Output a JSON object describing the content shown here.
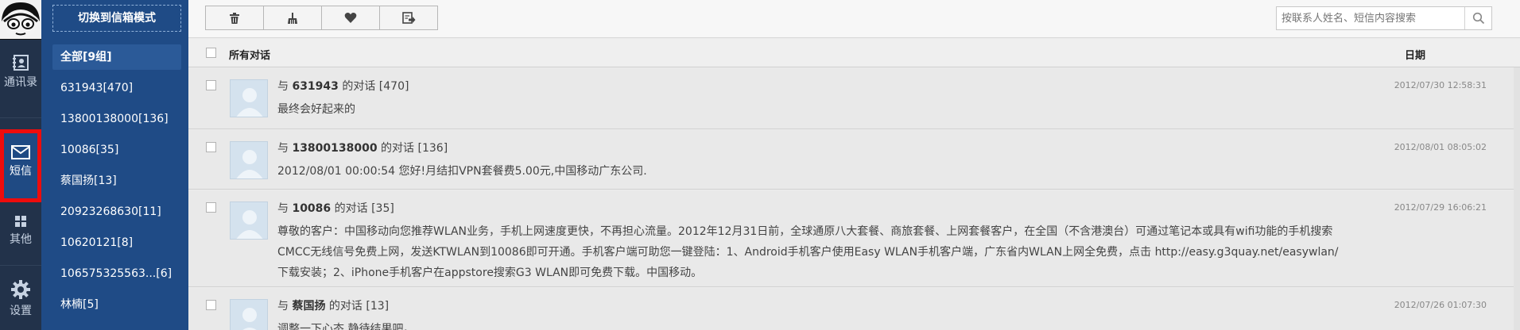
{
  "nav": {
    "contacts_label": "通讯录",
    "sms_label": "短信",
    "other_label": "其他",
    "settings_label": "设置"
  },
  "groups": {
    "switch_label": "切换到信箱模式",
    "items": [
      {
        "label": "全部[9组]"
      },
      {
        "label": "631943[470]"
      },
      {
        "label": "13800138000[136]"
      },
      {
        "label": "10086[35]"
      },
      {
        "label": "蔡国扬[13]"
      },
      {
        "label": "20923268630[11]"
      },
      {
        "label": "10620121[8]"
      },
      {
        "label": "106575325563...[6]"
      },
      {
        "label": "林楠[5]"
      }
    ]
  },
  "toolbar": {
    "icons": [
      "trash-icon",
      "broom-icon",
      "heart-icon",
      "export-icon"
    ],
    "search_placeholder": "按联系人姓名、短信内容搜索"
  },
  "list": {
    "all_label": "所有对话",
    "date_label": "日期",
    "conversations": [
      {
        "prefix": "与 ",
        "name": "631943",
        "suffix": " 的对话 [470]",
        "body": "最终会好起来的",
        "date": "2012/07/30 12:58:31"
      },
      {
        "prefix": "与 ",
        "name": "13800138000",
        "suffix": " 的对话 [136]",
        "body": "2012/08/01 00:00:54 您好!月结扣VPN套餐费5.00元,中国移动广东公司.",
        "date": "2012/08/01 08:05:02"
      },
      {
        "prefix": "与 ",
        "name": "10086",
        "suffix": " 的对话 [35]",
        "body": "尊敬的客户：中国移动向您推荐WLAN业务，手机上网速度更快，不再担心流量。2012年12月31日前，全球通原八大套餐、商旅套餐、上网套餐客户，在全国（不含港澳台）可通过笔记本或具有wifi功能的手机搜索CMCC无线信号免费上网，发送KTWLAN到10086即可开通。手机客户端可助您一键登陆：1、Android手机客户使用Easy WLAN手机客户端，广东省内WLAN上网全免费，点击 http://easy.g3quay.net/easywlan/ 下载安装；2、iPhone手机客户在appstore搜索G3 WLAN即可免费下载。中国移动。",
        "date": "2012/07/29 16:06:21"
      },
      {
        "prefix": "与 ",
        "name": "蔡国扬",
        "suffix": " 的对话 [13]",
        "body": "调整一下心态,静待结果吧。",
        "date": "2012/07/26 01:07:30"
      }
    ]
  },
  "colors": {
    "rail": "#22324a",
    "group_panel": "#1f4b86",
    "active_highlight": "#ee0c0c"
  }
}
